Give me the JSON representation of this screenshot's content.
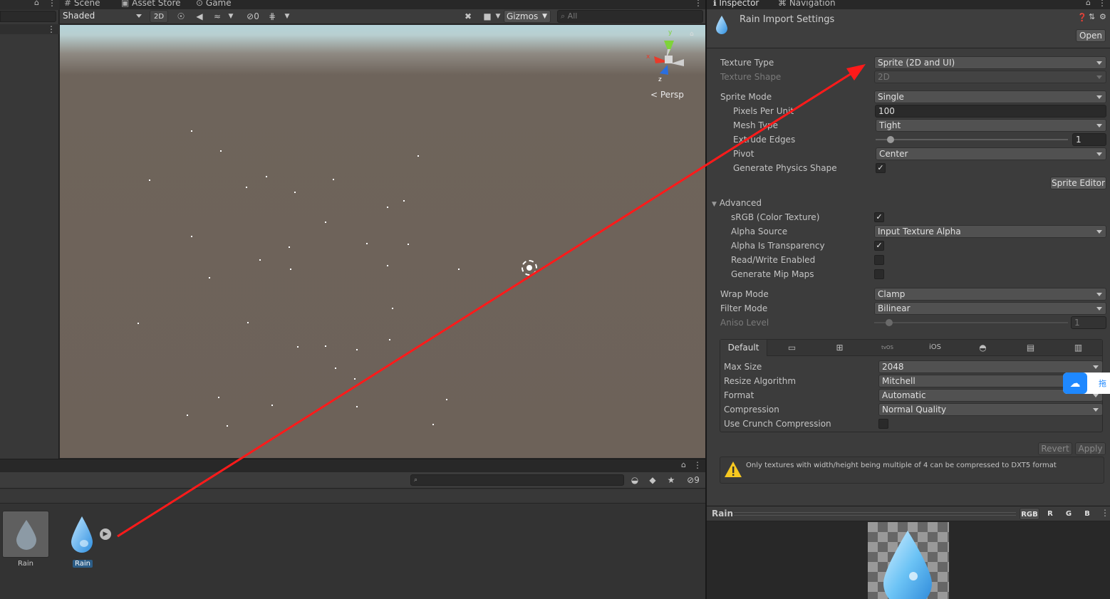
{
  "scene_tabs": [
    "Scene",
    "Asset Store",
    "Game"
  ],
  "scene_toolbar": {
    "shading": "Shaded",
    "mode_2d": "2D",
    "hidden_count": "0",
    "gizmos": "Gizmos",
    "search_placeholder": "All"
  },
  "scene_view": {
    "persp_label": "Persp",
    "axis_y": "y",
    "axis_x": "x",
    "axis_z": "z"
  },
  "project": {
    "hidden_count": "9",
    "assets": [
      {
        "label": "Rain",
        "selected": false
      },
      {
        "label": "Rain",
        "selected": true
      }
    ]
  },
  "inspector_tabs": [
    "Inspector",
    "Navigation"
  ],
  "inspector": {
    "title": "Rain Import Settings",
    "open_button": "Open",
    "texture_type": {
      "label": "Texture Type",
      "value": "Sprite (2D and UI)"
    },
    "texture_shape": {
      "label": "Texture Shape",
      "value": "2D"
    },
    "sprite_mode": {
      "label": "Sprite Mode",
      "value": "Single"
    },
    "pixels_per_unit": {
      "label": "Pixels Per Unit",
      "value": "100"
    },
    "mesh_type": {
      "label": "Mesh Type",
      "value": "Tight"
    },
    "extrude_edges": {
      "label": "Extrude Edges",
      "value": "1",
      "fraction": 0.06
    },
    "pivot": {
      "label": "Pivot",
      "value": "Center"
    },
    "generate_physics_shape": {
      "label": "Generate Physics Shape",
      "checked": true
    },
    "sprite_editor_button": "Sprite Editor",
    "advanced": {
      "header": "Advanced",
      "srgb": {
        "label": "sRGB (Color Texture)",
        "checked": true
      },
      "alpha_source": {
        "label": "Alpha Source",
        "value": "Input Texture Alpha"
      },
      "alpha_is_transparency": {
        "label": "Alpha Is Transparency",
        "checked": true
      },
      "read_write": {
        "label": "Read/Write Enabled",
        "checked": false
      },
      "mip_maps": {
        "label": "Generate Mip Maps",
        "checked": false
      }
    },
    "wrap_mode": {
      "label": "Wrap Mode",
      "value": "Clamp"
    },
    "filter_mode": {
      "label": "Filter Mode",
      "value": "Bilinear"
    },
    "aniso_level": {
      "label": "Aniso Level",
      "value": "1",
      "fraction": 0.06
    },
    "platform_tabs": {
      "default": "Default",
      "tvos": "tvOS",
      "ios": "iOS"
    },
    "max_size": {
      "label": "Max Size",
      "value": "2048"
    },
    "resize_algorithm": {
      "label": "Resize Algorithm",
      "value": "Mitchell"
    },
    "format": {
      "label": "Format",
      "value": "Automatic"
    },
    "compression": {
      "label": "Compression",
      "value": "Normal Quality"
    },
    "crunch": {
      "label": "Use Crunch Compression",
      "checked": false
    },
    "revert_button": "Revert",
    "apply_button": "Apply",
    "warning": "Only textures with width/height being multiple of 4 can be compressed to DXT5 format",
    "side_badge": "拖"
  },
  "preview": {
    "title": "Rain",
    "channels": [
      "RGB",
      "R",
      "G",
      "B"
    ]
  },
  "colors": {
    "annotation_arrow": "#ff1a1a",
    "sky": "#b5d3d9",
    "ground": "#6d6259",
    "droplet": "#5ab4ee"
  }
}
